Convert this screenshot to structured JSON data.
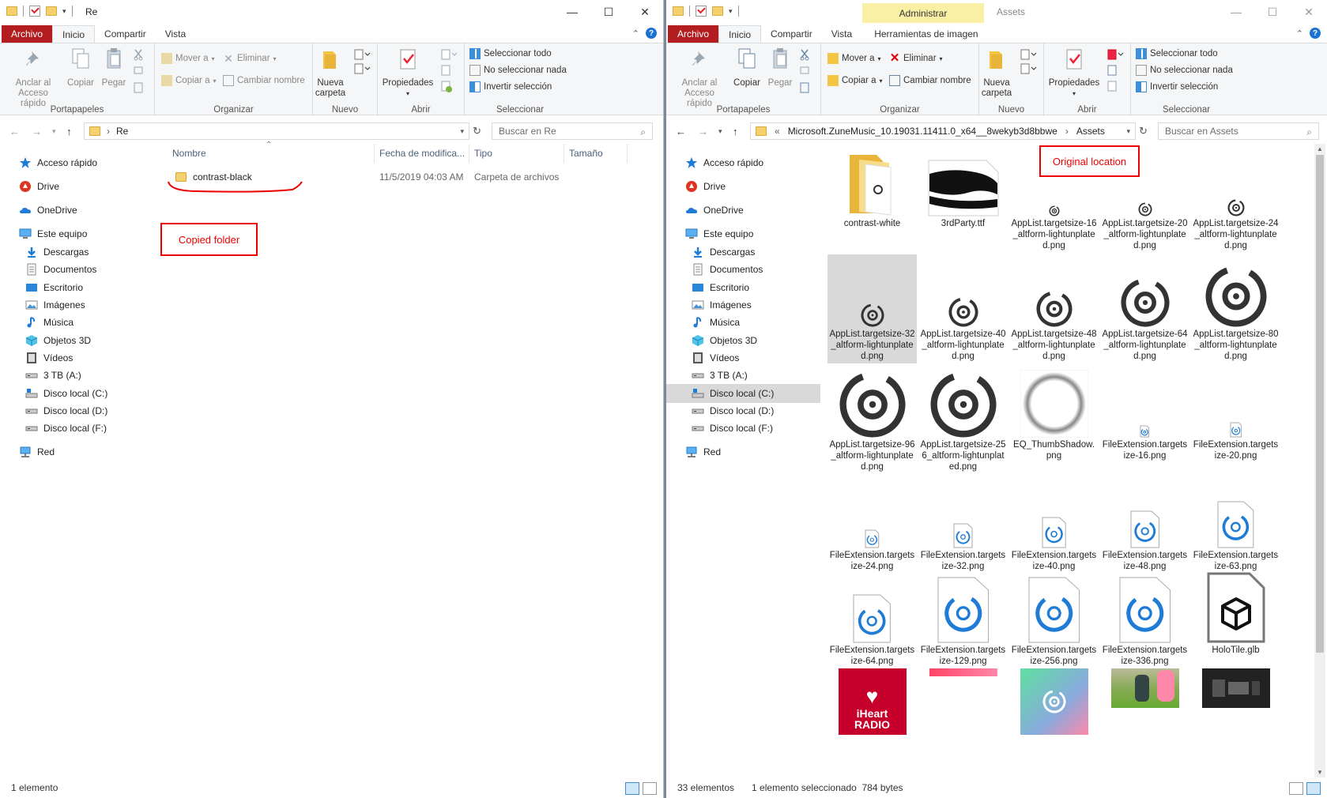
{
  "left": {
    "title": "Re",
    "tabs": {
      "file": "Archivo",
      "home": "Inicio",
      "share": "Compartir",
      "view": "Vista"
    },
    "ribbon": {
      "pin": "Anclar al\nAcceso rápido",
      "copy": "Copiar",
      "paste": "Pegar",
      "clipboard": "Portapapeles",
      "move_to": "Mover a",
      "copy_to": "Copiar a",
      "delete": "Eliminar",
      "rename": "Cambiar nombre",
      "organize": "Organizar",
      "new_folder": "Nueva\ncarpeta",
      "new": "Nuevo",
      "properties": "Propiedades",
      "open": "Abrir",
      "select_all": "Seleccionar todo",
      "select_none": "No seleccionar nada",
      "invert": "Invertir selección",
      "select": "Seleccionar"
    },
    "address": {
      "path": "Re",
      "search_placeholder": "Buscar en Re"
    },
    "columns": {
      "name": "Nombre",
      "date": "Fecha de modifica...",
      "type": "Tipo",
      "size": "Tamaño"
    },
    "file": {
      "name": "contrast-black",
      "date": "11/5/2019 04:03 AM",
      "type": "Carpeta de archivos"
    },
    "callout": "Copied folder",
    "status": "1 elemento"
  },
  "right": {
    "title": "Assets",
    "context_tab": "Administrar",
    "tabs": {
      "file": "Archivo",
      "home": "Inicio",
      "share": "Compartir",
      "view": "Vista",
      "tools": "Herramientas de imagen"
    },
    "ribbon": {
      "pin": "Anclar al\nAcceso rápido",
      "copy": "Copiar",
      "paste": "Pegar",
      "clipboard": "Portapapeles",
      "move_to": "Mover a",
      "copy_to": "Copiar a",
      "delete": "Eliminar",
      "rename": "Cambiar nombre",
      "organize": "Organizar",
      "new_folder": "Nueva\ncarpeta",
      "new": "Nuevo",
      "properties": "Propiedades",
      "open": "Abrir",
      "select_all": "Seleccionar todo",
      "select_none": "No seleccionar nada",
      "invert": "Invertir selección",
      "select": "Seleccionar"
    },
    "address": {
      "prefix": "«",
      "segment1": "Microsoft.ZuneMusic_10.19031.11411.0_x64__8wekyb3d8bbwe",
      "segment2": "Assets",
      "search_placeholder": "Buscar en Assets"
    },
    "callout": "Original location",
    "status": "33 elementos",
    "selection": "1 elemento seleccionado",
    "size": "784 bytes",
    "files": [
      {
        "name": "contrast-white",
        "kind": "folder"
      },
      {
        "name": "3rdParty.ttf",
        "kind": "font"
      },
      {
        "name": "AppList.targetsize-16_altform-lightunplated.png",
        "kind": "disc",
        "size": 14
      },
      {
        "name": "AppList.targetsize-20_altform-lightunplated.png",
        "kind": "disc",
        "size": 18
      },
      {
        "name": "AppList.targetsize-24_altform-lightunplated.png",
        "kind": "disc",
        "size": 22
      },
      {
        "name": "AppList.targetsize-32_altform-lightunplated.png",
        "kind": "disc",
        "size": 30
      },
      {
        "name": "AppList.targetsize-40_altform-lightunplated.png",
        "kind": "disc",
        "size": 38
      },
      {
        "name": "AppList.targetsize-48_altform-lightunplated.png",
        "kind": "disc",
        "size": 46
      },
      {
        "name": "AppList.targetsize-64_altform-lightunplated.png",
        "kind": "disc",
        "size": 62
      },
      {
        "name": "AppList.targetsize-80_altform-lightunplated.png",
        "kind": "disc",
        "size": 78
      },
      {
        "name": "AppList.targetsize-96_altform-lightunplated.png",
        "kind": "disc",
        "size": 84
      },
      {
        "name": "AppList.targetsize-256_altform-lightunplated.png",
        "kind": "disc",
        "size": 84
      },
      {
        "name": "EQ_ThumbShadow.png",
        "kind": "shadow"
      },
      {
        "name": "FileExtension.targetsize-16.png",
        "kind": "doc",
        "size": 16
      },
      {
        "name": "FileExtension.targetsize-20.png",
        "kind": "doc",
        "size": 20
      },
      {
        "name": "FileExtension.targetsize-24.png",
        "kind": "doc",
        "size": 24
      },
      {
        "name": "FileExtension.targetsize-32.png",
        "kind": "doc",
        "size": 32
      },
      {
        "name": "FileExtension.targetsize-40.png",
        "kind": "doc",
        "size": 40
      },
      {
        "name": "FileExtension.targetsize-48.png",
        "kind": "doc",
        "size": 48
      },
      {
        "name": "FileExtension.targetsize-63.png",
        "kind": "doc",
        "size": 60
      },
      {
        "name": "FileExtension.targetsize-64.png",
        "kind": "doc",
        "size": 62
      },
      {
        "name": "FileExtension.targetsize-129.png",
        "kind": "doc",
        "size": 84
      },
      {
        "name": "FileExtension.targetsize-256.png",
        "kind": "doc",
        "size": 84
      },
      {
        "name": "FileExtension.targetsize-336.png",
        "kind": "doc",
        "size": 84
      },
      {
        "name": "HoloTile.glb",
        "kind": "cube"
      },
      {
        "name": "",
        "kind": "iheart",
        "logo_text": "iHeart\nRADIO"
      },
      {
        "name": "",
        "kind": "pinkstrip"
      },
      {
        "name": "",
        "kind": "gradient"
      },
      {
        "name": "",
        "kind": "photo1"
      },
      {
        "name": "",
        "kind": "photo2"
      }
    ]
  },
  "nav": [
    "Acceso rápido",
    "Drive",
    "OneDrive",
    "Este equipo",
    "Descargas",
    "Documentos",
    "Escritorio",
    "Imágenes",
    "Música",
    "Objetos 3D",
    "Vídeos",
    "3 TB (A:)",
    "Disco local (C:)",
    "Disco local (D:)",
    "Disco local (F:)",
    "Red"
  ],
  "nav_icons": [
    "star-icon",
    "drive-icon",
    "onedrive-icon",
    "computer-icon",
    "downloads-icon",
    "documents-icon",
    "desktop-icon",
    "pictures-icon",
    "music-icon",
    "objects3d-icon",
    "videos-icon",
    "drive-a-icon",
    "drive-c-icon",
    "drive-d-icon",
    "drive-f-icon",
    "network-icon"
  ],
  "colors": {
    "file_tab": "#b31d20",
    "accent_blue": "#0078d7",
    "callout_red": "#e00000",
    "selection": "#d9d9d9",
    "context_yellow": "#f9f0a6"
  }
}
